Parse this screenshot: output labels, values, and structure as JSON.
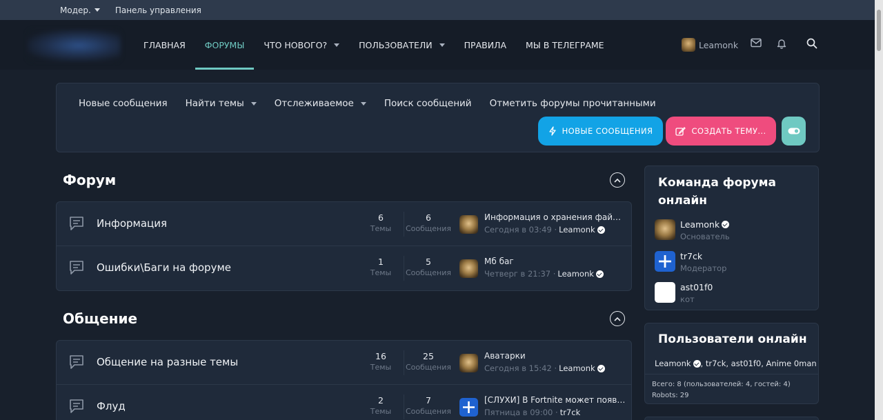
{
  "topbar": {
    "moderator": "Модер.",
    "control_panel": "Панель управления"
  },
  "nav": {
    "home": "ГЛАВНАЯ",
    "forums": "ФОРУМЫ",
    "whats_new": "ЧТО НОВОГО?",
    "users": "ПОЛЬЗОВАТЕЛИ",
    "rules": "ПРАВИЛА",
    "telegram": "МЫ В ТЕЛЕГРАМЕ"
  },
  "header_user": {
    "name": "Leamonk"
  },
  "subnav": {
    "new_posts": "Новые сообщения",
    "find_threads": "Найти темы",
    "watched": "Отслеживаемое",
    "search_posts": "Поиск сообщений",
    "mark_read": "Отметить форумы прочитанными"
  },
  "buttons": {
    "new_posts": "НОВЫЕ СООБЩЕНИЯ",
    "create_thread": "СОЗДАТЬ ТЕМУ..."
  },
  "stat_labels": {
    "threads": "Темы",
    "messages": "Сообщения"
  },
  "categories": [
    {
      "title": "Форум",
      "nodes": [
        {
          "title": "Информация",
          "threads": "6",
          "messages": "6",
          "last_title": "Информация о хранения файлов",
          "last_time": "Сегодня в 03:49 ·",
          "last_user": "Leamonk",
          "verified": true,
          "avatar": "burger"
        },
        {
          "title": "Ошибки\\Баги на форуме",
          "threads": "1",
          "messages": "5",
          "last_title": "Мб баг",
          "last_time": "Четверг в 21:37 ·",
          "last_user": "Leamonk",
          "verified": true,
          "avatar": "burger"
        }
      ]
    },
    {
      "title": "Общение",
      "nodes": [
        {
          "title": "Общение на разные темы",
          "threads": "16",
          "messages": "25",
          "last_title": "Аватарки",
          "last_time": "Сегодня в 15:42 ·",
          "last_user": "Leamonk",
          "verified": true,
          "avatar": "burger"
        },
        {
          "title": "Флуд",
          "threads": "2",
          "messages": "7",
          "last_title": "[СЛУХИ] В Fortnite может появить...",
          "last_time": "Пятница в 09:00 ·",
          "last_user": "tr7ck",
          "verified": false,
          "avatar": "plus"
        }
      ]
    }
  ],
  "staff": {
    "title": "Команда форума онлайн",
    "members": [
      {
        "name": "Leamonk",
        "role": "Основатель",
        "verified": true,
        "avatar": "burger"
      },
      {
        "name": "tr7ck",
        "role": "Модератор",
        "verified": false,
        "avatar": "plus"
      },
      {
        "name": "ast01f0",
        "role": "кот",
        "verified": false,
        "avatar": "cat"
      }
    ]
  },
  "online": {
    "title": "Пользователи онлайн",
    "first_user": "Leamonk",
    "rest": ", tr7ck, ast01f0, Anime 0man",
    "total": "Всего: 8 (пользователей: 4, гостей: 4)",
    "robots": "Robots: 29"
  },
  "colors": {
    "background": "#18202c",
    "accent_teal": "#6fc9c2",
    "button_blue": "#12a3e6",
    "button_pink": "#ef4c7e"
  }
}
